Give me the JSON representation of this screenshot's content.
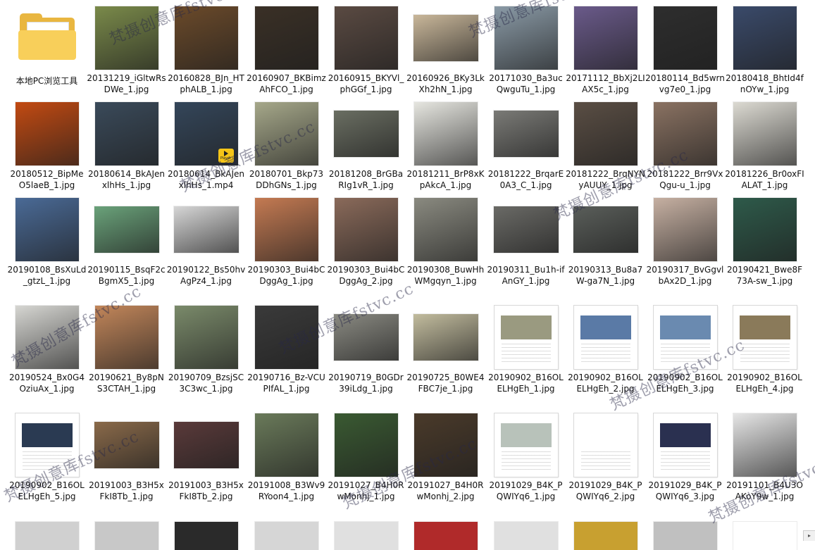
{
  "app": "File Explorer (large icons view)",
  "folder": {
    "label": "本地PC浏览工具",
    "icon": "folder-icon"
  },
  "files": [
    {
      "name": "20131219_iGltwRsDWe_1.jpg",
      "color": "#7a8a4a",
      "kind": "photo"
    },
    {
      "name": "20160828_BJn_HTphALB_1.jpg",
      "color": "#6b4a2a",
      "kind": "photo"
    },
    {
      "name": "20160907_BKBimzAhFCO_1.jpg",
      "color": "#3a3026",
      "kind": "photo"
    },
    {
      "name": "20160915_BKYVl_phGGf_1.jpg",
      "color": "#5a4a42",
      "kind": "photo"
    },
    {
      "name": "20160926_BKy3LkXh2hN_1.jpg",
      "color": "#c9b79a",
      "kind": "photo-land"
    },
    {
      "name": "20171030_Ba3ucQwguTu_1.jpg",
      "color": "#8a9aa6",
      "kind": "photo"
    },
    {
      "name": "20171112_BbXj2LIAX5c_1.jpg",
      "color": "#6a5a8a",
      "kind": "photo"
    },
    {
      "name": "20180114_Bd5wrnvg7e0_1.jpg",
      "color": "#2e2e2e",
      "kind": "photo"
    },
    {
      "name": "20180418_BhtId4fnOYw_1.jpg",
      "color": "#3a4a6a",
      "kind": "photo"
    },
    {
      "name": "20180512_BipMeO5laeB_1.jpg",
      "color": "#c24a12",
      "kind": "photo"
    },
    {
      "name": "20180614_BkAJenxlhHs_1.jpg",
      "color": "#3a4a5a",
      "kind": "photo"
    },
    {
      "name": "20180614_BkAJenxlhHs_1.mp4",
      "color": "#34465a",
      "kind": "video",
      "badge": "Player"
    },
    {
      "name": "20180701_Bkp73DDhGNs_1.jpg",
      "color": "#a6a88a",
      "kind": "photo"
    },
    {
      "name": "20181208_BrGBaRIg1vR_1.jpg",
      "color": "#6a6e62",
      "kind": "photo-land"
    },
    {
      "name": "20181211_BrP8xKpAkcA_1.jpg",
      "color": "#e6e6e0",
      "kind": "photo"
    },
    {
      "name": "20181222_BrqarE0A3_C_1.jpg",
      "color": "#7a7a76",
      "kind": "photo-land"
    },
    {
      "name": "20181222_BrqNYNyAUUY_1.jpg",
      "color": "#5a4e44",
      "kind": "photo"
    },
    {
      "name": "20181222_Brr9VxQgu-u_1.jpg",
      "color": "#8a7262",
      "kind": "photo"
    },
    {
      "name": "20181226_Br0oxFIALAT_1.jpg",
      "color": "#dcdad2",
      "kind": "photo"
    },
    {
      "name": "20190108_BsXuLd_gtzL_1.jpg",
      "color": "#4a6a96",
      "kind": "photo"
    },
    {
      "name": "20190115_BsqF2cBgmX5_1.jpg",
      "color": "#6aa27a",
      "kind": "photo-land"
    },
    {
      "name": "20190122_Bs50hvAgPz4_1.jpg",
      "color": "#d6d6d6",
      "kind": "photo-land"
    },
    {
      "name": "20190303_Bui4bCDggAg_1.jpg",
      "color": "#c47a52",
      "kind": "photo"
    },
    {
      "name": "20190303_Bui4bCDggAg_2.jpg",
      "color": "#8a6a5a",
      "kind": "photo"
    },
    {
      "name": "20190308_BuwHhWMgqyn_1.jpg",
      "color": "#8a8a80",
      "kind": "photo"
    },
    {
      "name": "20190311_Bu1h-ifAnGY_1.jpg",
      "color": "#6a6a66",
      "kind": "photo-land"
    },
    {
      "name": "20190313_Bu8a7W-ga7N_1.jpg",
      "color": "#5a5e5a",
      "kind": "photo-land"
    },
    {
      "name": "20190317_BvGgvlbAx2D_1.jpg",
      "color": "#c6b0a2",
      "kind": "photo"
    },
    {
      "name": "20190421_Bwe8F73A-sw_1.jpg",
      "color": "#2e5a4a",
      "kind": "photo"
    },
    {
      "name": "20190524_Bx0G4OziuAx_1.jpg",
      "color": "#d6d6d2",
      "kind": "photo"
    },
    {
      "name": "20190621_By8pNS3CTAH_1.jpg",
      "color": "#c2865a",
      "kind": "photo"
    },
    {
      "name": "20190709_BzsjSC3C3wc_1.jpg",
      "color": "#7a8a6a",
      "kind": "photo"
    },
    {
      "name": "20190716_Bz-VCUPIfAL_1.jpg",
      "color": "#3a3a3a",
      "kind": "photo"
    },
    {
      "name": "20190719_B0GDr39iLdg_1.jpg",
      "color": "#8a8a82",
      "kind": "photo-land"
    },
    {
      "name": "20190725_B0WE4FBC7je_1.jpg",
      "color": "#c2bc9e",
      "kind": "photo-land"
    },
    {
      "name": "20190902_B16OLELHgEh_1.jpg",
      "color": "#ffffff",
      "kind": "page",
      "accent": "#9a9a80"
    },
    {
      "name": "20190902_B16OLELHgEh_2.jpg",
      "color": "#ffffff",
      "kind": "page",
      "accent": "#5a7aa6"
    },
    {
      "name": "20190902_B16OLELHgEh_3.jpg",
      "color": "#ffffff",
      "kind": "page",
      "accent": "#6a8ab0"
    },
    {
      "name": "20190902_B16OLELHgEh_4.jpg",
      "color": "#ffffff",
      "kind": "page",
      "accent": "#8a7a5a"
    },
    {
      "name": "20190902_B16OLELHgEh_5.jpg",
      "color": "#ffffff",
      "kind": "page",
      "accent": "#2a3a52"
    },
    {
      "name": "20191003_B3H5xFkI8Tb_1.jpg",
      "color": "#8a6a4a",
      "kind": "photo-land"
    },
    {
      "name": "20191003_B3H5xFkI8Tb_2.jpg",
      "color": "#5a3a3a",
      "kind": "photo-land"
    },
    {
      "name": "20191008_B3Wv9RYoon4_1.jpg",
      "color": "#6a7a5a",
      "kind": "photo"
    },
    {
      "name": "20191027_B4H0RwMonhj_1.jpg",
      "color": "#3a5a32",
      "kind": "photo"
    },
    {
      "name": "20191027_B4H0RwMonhj_2.jpg",
      "color": "#4a3a2a",
      "kind": "photo"
    },
    {
      "name": "20191029_B4K_PQWIYq6_1.jpg",
      "color": "#ffffff",
      "kind": "page",
      "accent": "#b8c2ba"
    },
    {
      "name": "20191029_B4K_PQWIYq6_2.jpg",
      "color": "#ffffff",
      "kind": "page",
      "accent": "#ffffff"
    },
    {
      "name": "20191029_B4K_PQWIYq6_3.jpg",
      "color": "#ffffff",
      "kind": "page",
      "accent": "#2a3050"
    },
    {
      "name": "20191101_B4U3OAKoY9w_1.jpg",
      "color": "#e6e6e6",
      "kind": "photo"
    }
  ],
  "partial_row_colors": [
    "#d0d0d0",
    "#c8c8c8",
    "#2a2a2a",
    "#d6d6d6",
    "#e0e0e0",
    "#b02a2a",
    "#e0e0e0",
    "#c8a030",
    "#c0c0c0",
    "#ffffff"
  ],
  "watermark_text": "梵摄创意库fstvc.cc"
}
